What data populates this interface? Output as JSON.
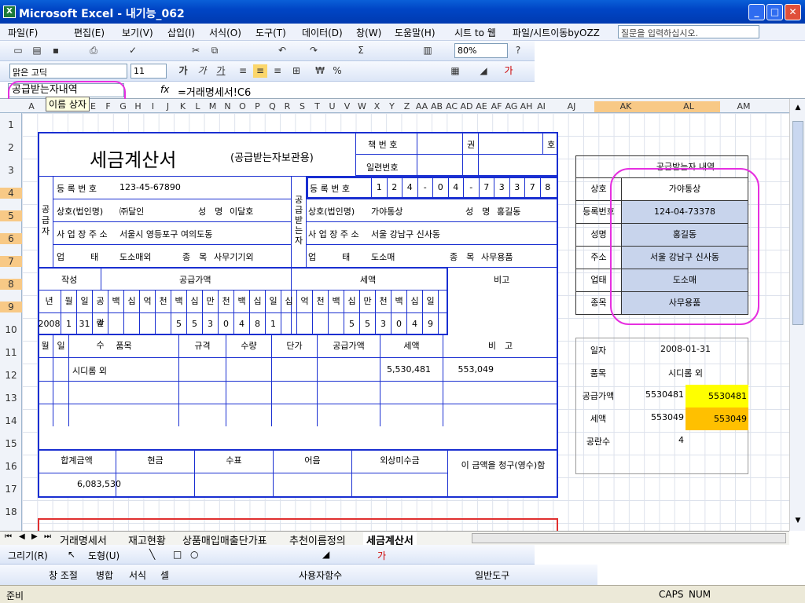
{
  "window": {
    "title": "Microsoft Excel - 내기능_062"
  },
  "menu": {
    "items": [
      "파일(F)",
      "편집(E)",
      "보기(V)",
      "삽입(I)",
      "서식(O)",
      "도구(T)",
      "데이터(D)",
      "창(W)",
      "도움말(H)",
      "시트 to 웹",
      "파일/시트이동byOZZ"
    ],
    "help_placeholder": "질문을 입력하십시오."
  },
  "toolbar": {
    "zoom": "80%",
    "font": "맑은 고딕",
    "size": "11"
  },
  "formula": {
    "name_box": "공급받는자내역",
    "fx": "fx",
    "content": "=거래명세서!C6",
    "name_popup": "이름 상자"
  },
  "columns": [
    "A",
    "B",
    "C",
    "D",
    "E",
    "F",
    "G",
    "H",
    "I",
    "J",
    "K",
    "L",
    "M",
    "N",
    "O",
    "P",
    "Q",
    "R",
    "S",
    "T",
    "U",
    "V",
    "W",
    "X",
    "Y",
    "Z",
    "AA",
    "AB",
    "AC",
    "AD",
    "AE",
    "AF",
    "AG",
    "AH",
    "AI",
    "AJ",
    "AK",
    "AL",
    "AM"
  ],
  "rows": [
    "1",
    "2",
    "3",
    "4",
    "5",
    "6",
    "7",
    "8",
    "9",
    "10",
    "11",
    "12",
    "13",
    "14",
    "15",
    "16",
    "17",
    "18"
  ],
  "invoice": {
    "title": "세금계산서",
    "subtitle": "(공급받는자보관용)",
    "book_no": "책 번 호",
    "serial_no": "일련번호",
    "kwon": "권",
    "ho": "호",
    "supplier": "공급자",
    "receiver": "공급받는자",
    "reg_label": "등 록 번 호",
    "reg_no": "123-45-67890",
    "recv_reg_digits": [
      "1",
      "2",
      "4",
      "-",
      "0",
      "4",
      "-",
      "7",
      "3",
      "3",
      "7",
      "8"
    ],
    "company_label": "상호(법인명)",
    "company": "㈜달인",
    "name_label": "성　명",
    "name": "이달호",
    "recv_company": "가야통상",
    "recv_name": "홍길동",
    "addr_label": "사 업 장 주 소",
    "addr": "서울시 영등포구 여의도동",
    "recv_addr": "서울 강남구 신사동",
    "biz_label": "업　　　태",
    "biz": "도소매외",
    "item_label": "종　목",
    "item": "사무기기외",
    "recv_biz": "도소매",
    "recv_item": "사무용품",
    "write": "작성",
    "supply_amt": "공급가액",
    "tax": "세액",
    "note": "비고",
    "date_hdr": [
      "년",
      "월",
      "일"
    ],
    "blank_hdr": "공란수",
    "digit_hdr": [
      "백",
      "십",
      "억",
      "천",
      "백",
      "십",
      "만",
      "천",
      "백",
      "십",
      "일"
    ],
    "tax_digit_hdr": [
      "십",
      "억",
      "천",
      "백",
      "십",
      "만",
      "천",
      "백",
      "십",
      "일"
    ],
    "year": "2008",
    "month": "1",
    "day": "31",
    "blanks": "4",
    "supply_digits": [
      "5",
      "5",
      "3",
      "0",
      "4",
      "8",
      "1"
    ],
    "tax_digits": [
      "5",
      "5",
      "3",
      "0",
      "4",
      "9"
    ],
    "line_hdr": [
      "월",
      "일",
      "품목",
      "규격",
      "수량",
      "단가",
      "공급가액",
      "세액",
      "비　고"
    ],
    "line_item": "시디롬 외",
    "line_supply": "5,530,481",
    "line_tax": "553,049",
    "total_label": "합계금액",
    "cash": "현금",
    "check": "수표",
    "bill": "어음",
    "credit": "외상미수금",
    "claim": "이 금액을 청구(영수)함",
    "total": "6,083,530"
  },
  "side": {
    "title": "공급받는자 내역",
    "rows": [
      [
        "상호",
        "가야통상"
      ],
      [
        "등록번호",
        "124-04-73378"
      ],
      [
        "성명",
        "홍길동"
      ],
      [
        "주소",
        "서울 강남구 신사동"
      ],
      [
        "업태",
        "도소매"
      ],
      [
        "종목",
        "사무용품"
      ]
    ],
    "date_label": "일자",
    "date": "2008-01-31",
    "item_label": "품목",
    "item": "시디롬 외",
    "supply_label": "공급가액",
    "supply_a": "5530481",
    "supply_b": "5530481",
    "tax_label": "세액",
    "tax_a": "553049",
    "tax_b": "553049",
    "blank_label": "공란수",
    "blank": "4"
  },
  "tabs": [
    "거래명세서",
    "재고현황",
    "상품매입매출단가표",
    "추천이름정의",
    "세금계산서"
  ],
  "drawbar": {
    "draw": "그리기(R)",
    "shape": "도형(U)"
  },
  "toolbar2": {
    "items": [
      "창 조절",
      "병합",
      "서식",
      "셀",
      "사용자함수",
      "일반도구"
    ]
  },
  "status": {
    "ready": "준비",
    "caps": "CAPS",
    "num": "NUM"
  },
  "colors": {
    "accent": "#1a2fd1",
    "highlight_yellow": "#ffff00",
    "highlight_orange": "#ffc000",
    "annotation": "#e62fe0"
  }
}
